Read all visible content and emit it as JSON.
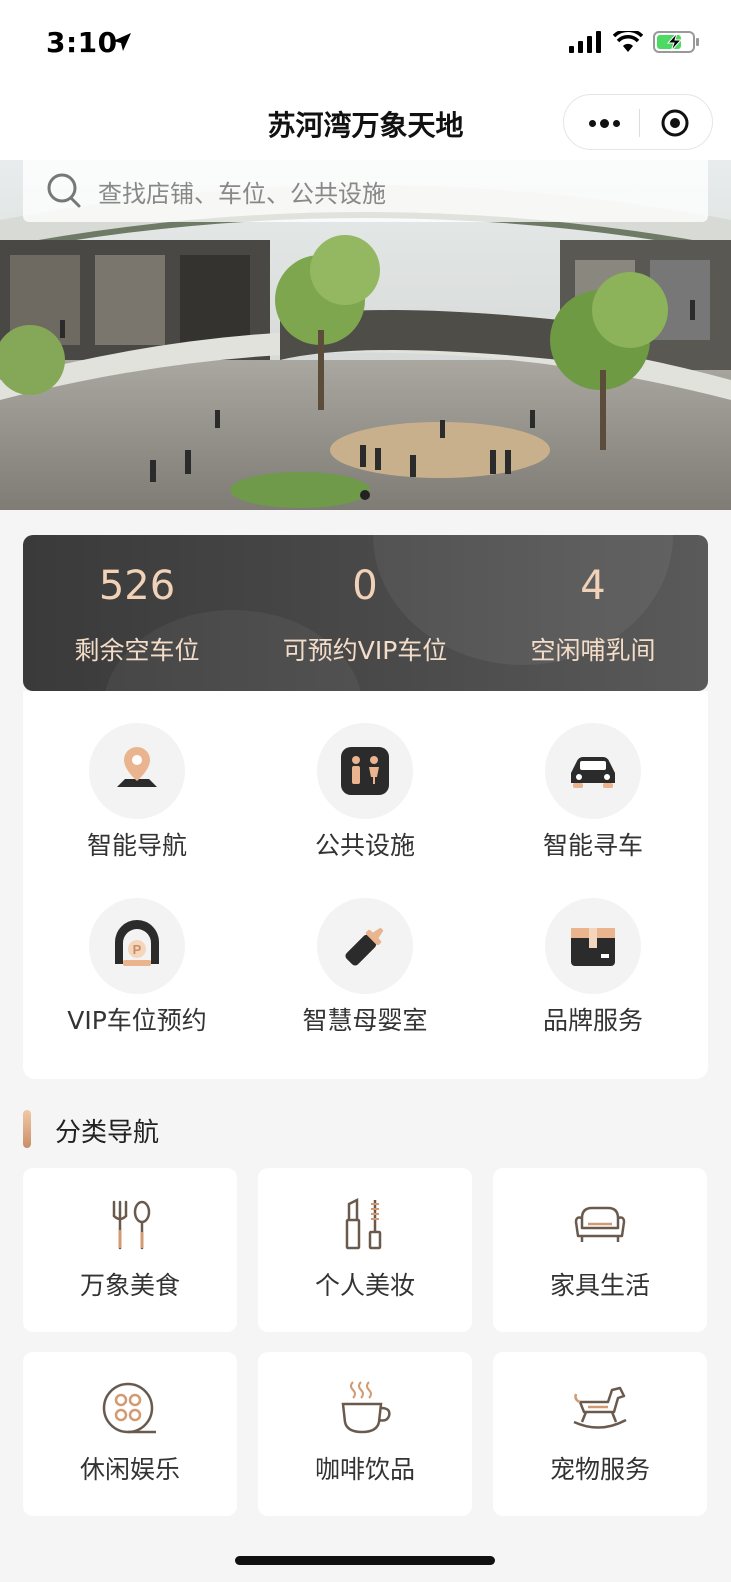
{
  "status_bar": {
    "time": "3:10"
  },
  "nav": {
    "title": "苏河湾万象天地"
  },
  "search": {
    "placeholder": "查找店铺、车位、公共设施"
  },
  "stats": [
    {
      "value": "526",
      "label": "剩余空车位"
    },
    {
      "value": "0",
      "label": "可预约VIP车位"
    },
    {
      "value": "4",
      "label": "空闲哺乳间"
    }
  ],
  "services": [
    {
      "label": "智能导航",
      "icon": "location-pin-icon"
    },
    {
      "label": "公共设施",
      "icon": "restroom-icon"
    },
    {
      "label": "智能寻车",
      "icon": "car-icon"
    },
    {
      "label": "VIP车位预约",
      "icon": "vip-parking-icon"
    },
    {
      "label": "智慧母婴室",
      "icon": "baby-bottle-icon"
    },
    {
      "label": "品牌服务",
      "icon": "package-icon"
    }
  ],
  "section": {
    "title": "分类导航"
  },
  "categories": [
    {
      "label": "万象美食",
      "icon": "fork-spoon-icon"
    },
    {
      "label": "个人美妆",
      "icon": "lipstick-icon"
    },
    {
      "label": "家具生活",
      "icon": "sofa-icon"
    },
    {
      "label": "休闲娱乐",
      "icon": "film-reel-icon"
    },
    {
      "label": "咖啡饮品",
      "icon": "coffee-cup-icon"
    },
    {
      "label": "宠物服务",
      "icon": "rocking-horse-icon"
    }
  ],
  "colors": {
    "accent": "#c98e67",
    "stat_text": "#f1d2b8",
    "stat_bg": "#454545"
  }
}
